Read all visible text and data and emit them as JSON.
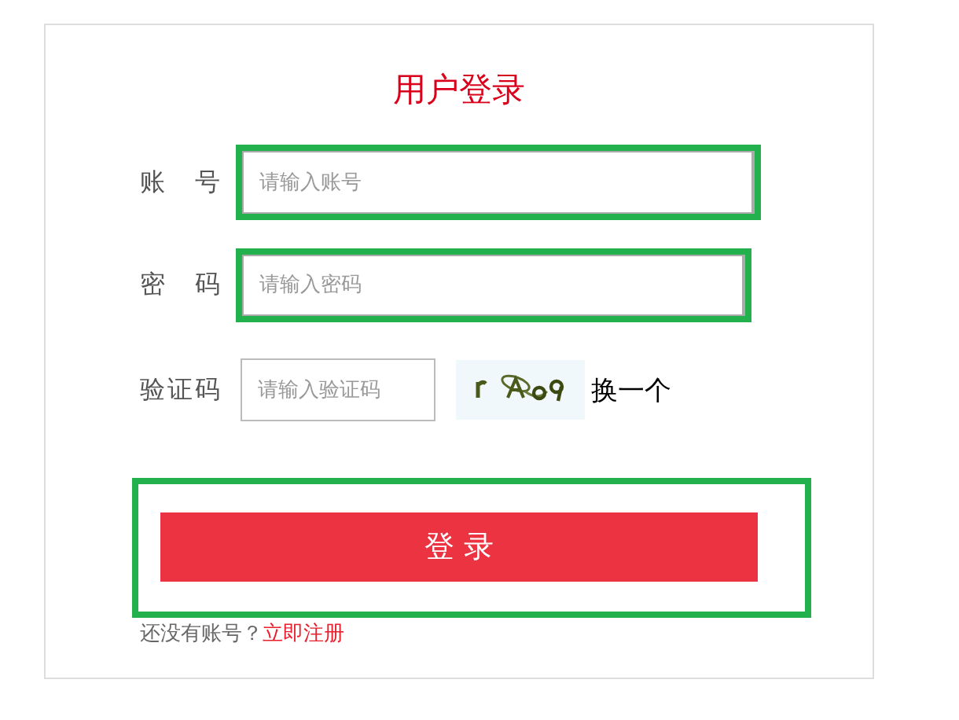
{
  "title": "用户登录",
  "fields": [
    {
      "label": "账 号",
      "placeholder": "请输入账号",
      "highlighted": true
    },
    {
      "label": "密 码",
      "placeholder": "请输入密码",
      "highlighted": true
    },
    {
      "label": "验证码",
      "placeholder": "请输入验证码",
      "highlighted": false
    }
  ],
  "captcha": {
    "kind": "picture",
    "refresh_link": "换一个"
  },
  "login_button": {
    "label": "登 录",
    "highlighted": true
  },
  "footer": {
    "text": "还没有账号？",
    "link": "立即注册"
  }
}
